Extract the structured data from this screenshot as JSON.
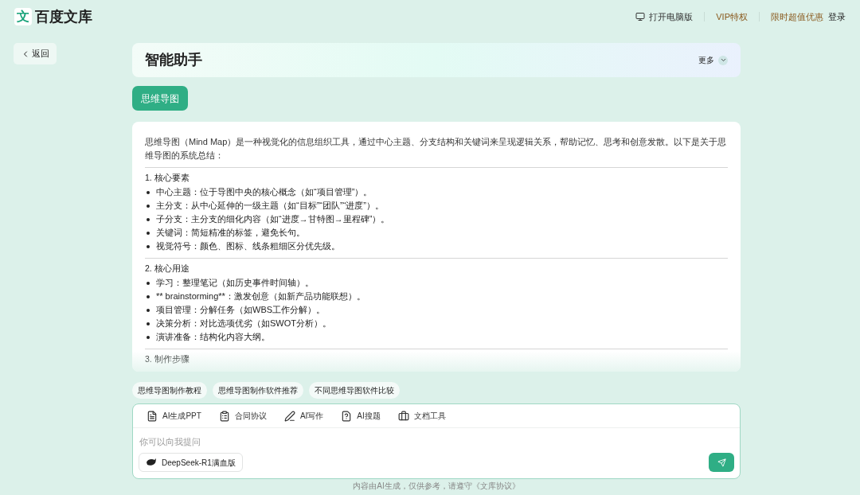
{
  "header": {
    "logo_mark": "文",
    "logo_text": "百度文库",
    "nav": [
      {
        "kind": "desktop",
        "label": "打开电脑版"
      },
      {
        "kind": "vip",
        "label": "VIP特权"
      },
      {
        "kind": "promo",
        "label": "限时超值优惠"
      },
      {
        "kind": "login",
        "label": "登录"
      }
    ]
  },
  "back_button": {
    "label": "返回"
  },
  "assistant": {
    "title": "智能助手",
    "more": "更多"
  },
  "tabs": [
    {
      "label": "思维导图",
      "selected": true
    }
  ],
  "answer": {
    "intro": "思维导图（Mind Map）是一种视觉化的信息组织工具，通过中心主题、分支结构和关键词来呈现逻辑关系，帮助记忆、思考和创意发散。以下是关于思维导图的系统总结：",
    "sections": [
      {
        "heading": "1. 核心要素",
        "items": [
          "中心主题：位于导图中央的核心概念（如“项目管理”）。",
          "主分支：从中心延伸的一级主题（如“目标”“团队”“进度”）。",
          "子分支：主分支的细化内容（如“进度→甘特图→里程碑”）。",
          "关键词：简短精准的标签，避免长句。",
          "视觉符号：颜色、图标、线条粗细区分优先级。"
        ]
      },
      {
        "heading": "2. 核心用途",
        "items": [
          "学习：整理笔记（如历史事件时间轴）。",
          "** brainstorming**：激发创意（如新产品功能联想）。",
          "项目管理：分解任务（如WBS工作分解）。",
          "决策分析：对比选项优劣（如SWOT分析）。",
          "演讲准备：结构化内容大纲。"
        ]
      },
      {
        "heading": "3. 制作步骤"
      }
    ]
  },
  "suggestions": [
    "思维导图制作教程",
    "思维导图制作软件推荐",
    "不同思维导图软件比较"
  ],
  "tools": [
    {
      "kind": "ppt",
      "label": "AI生成PPT"
    },
    {
      "kind": "contract",
      "label": "合同协议"
    },
    {
      "kind": "write",
      "label": "AI写作"
    },
    {
      "kind": "question",
      "label": "AI搜题"
    },
    {
      "kind": "docs",
      "label": "文档工具"
    }
  ],
  "input": {
    "placeholder": "你可以向我提问",
    "model": "DeepSeek-R1满血版"
  },
  "footer": "内容由AI生成，仅供参考，请遵守《文库协议》"
}
